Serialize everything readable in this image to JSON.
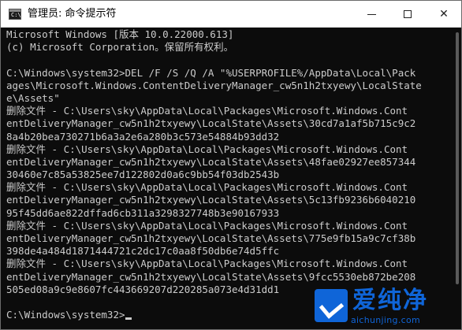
{
  "window": {
    "title": "管理员: 命令提示符",
    "icon_text": "C:\\"
  },
  "console": {
    "lines": [
      "Microsoft Windows [版本 10.0.22000.613]",
      "(c) Microsoft Corporation。保留所有权利。",
      "",
      "C:\\Windows\\system32>DEL /F /S /Q /A \"%USERPROFILE%/AppData\\Local\\Pack",
      "ages\\Microsoft.Windows.ContentDeliveryManager_cw5n1h2txyewy\\LocalState",
      "e\\Assets\"",
      "删除文件 - C:\\Users\\sky\\AppData\\Local\\Packages\\Microsoft.Windows.Cont",
      "entDeliveryManager_cw5n1h2txyewy\\LocalState\\Assets\\30cd7a1af5b715c9c2",
      "8a4b20bea730271b6a3a2e6a280b3c573e54884b93dd32",
      "删除文件 - C:\\Users\\sky\\AppData\\Local\\Packages\\Microsoft.Windows.Cont",
      "entDeliveryManager_cw5n1h2txyewy\\LocalState\\Assets\\48fae02927ee857344",
      "30460e7c85a53825ee7d122802d0a6c9bb54f03db2543b",
      "删除文件 - C:\\Users\\sky\\AppData\\Local\\Packages\\Microsoft.Windows.Cont",
      "entDeliveryManager_cw5n1h2txyewy\\LocalState\\Assets\\5c13fb9236b6040210",
      "95f45dd6ae822dffad6cb311a3298327748b3e90167933",
      "删除文件 - C:\\Users\\sky\\AppData\\Local\\Packages\\Microsoft.Windows.Cont",
      "entDeliveryManager_cw5n1h2txyewy\\LocalState\\Assets\\775e9fb15a9c7cf38b",
      "398de4a484d1871444721c2dc17c0aa8f50db6e74d5ffc",
      "删除文件 - C:\\Users\\sky\\AppData\\Local\\Packages\\Microsoft.Windows.Cont",
      "entDeliveryManager_cw5n1h2txyewy\\LocalState\\Assets\\9fcc5530eb872be208",
      "505ed08a9c9e8607fc443669207d220285a073e4d31dd1",
      ""
    ],
    "prompt": "C:\\Windows\\system32>"
  },
  "watermark": {
    "text": "爱纯净",
    "url": "aichunjing.com"
  },
  "colors": {
    "console_bg": "#0c0c0c",
    "console_fg": "#cccccc",
    "watermark": "#0f65d8"
  }
}
